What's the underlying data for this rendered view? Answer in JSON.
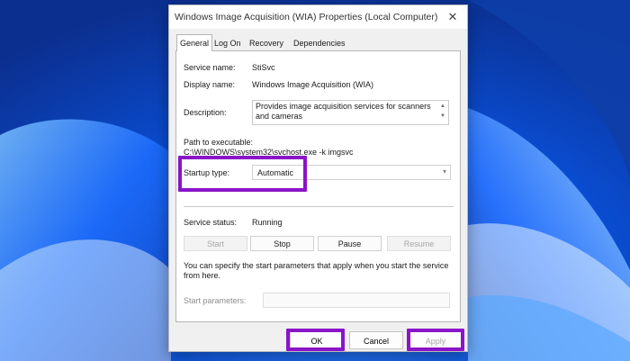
{
  "window": {
    "title": "Windows Image Acquisition (WIA) Properties (Local Computer)",
    "close_symbol": "✕"
  },
  "tabs": [
    {
      "label": "General",
      "active": true
    },
    {
      "label": "Log On",
      "active": false
    },
    {
      "label": "Recovery",
      "active": false
    },
    {
      "label": "Dependencies",
      "active": false
    }
  ],
  "general": {
    "service_name_label": "Service name:",
    "service_name_value": "StiSvc",
    "display_name_label": "Display name:",
    "display_name_value": "Windows Image Acquisition (WIA)",
    "description_label": "Description:",
    "description_value": "Provides image acquisition services for scanners and cameras",
    "path_label": "Path to executable:",
    "path_value": "C:\\WINDOWS\\system32\\svchost.exe -k imgsvc",
    "startup_type_label": "Startup type:",
    "startup_type_value": "Automatic",
    "service_status_label": "Service status:",
    "service_status_value": "Running",
    "buttons": {
      "start": "Start",
      "stop": "Stop",
      "pause": "Pause",
      "resume": "Resume"
    },
    "hint_line1": "You can specify the start parameters that apply when you start the service",
    "hint_line2": "from here.",
    "start_parameters_label": "Start parameters:",
    "start_parameters_value": ""
  },
  "footer": {
    "ok": "OK",
    "cancel": "Cancel",
    "apply": "Apply"
  },
  "colors": {
    "highlight": "#8b14c8",
    "wallpaper": "#0a4fd6"
  },
  "icons": {
    "dropdown": "▾",
    "scroll_up": "▲",
    "scroll_down": "▼"
  }
}
